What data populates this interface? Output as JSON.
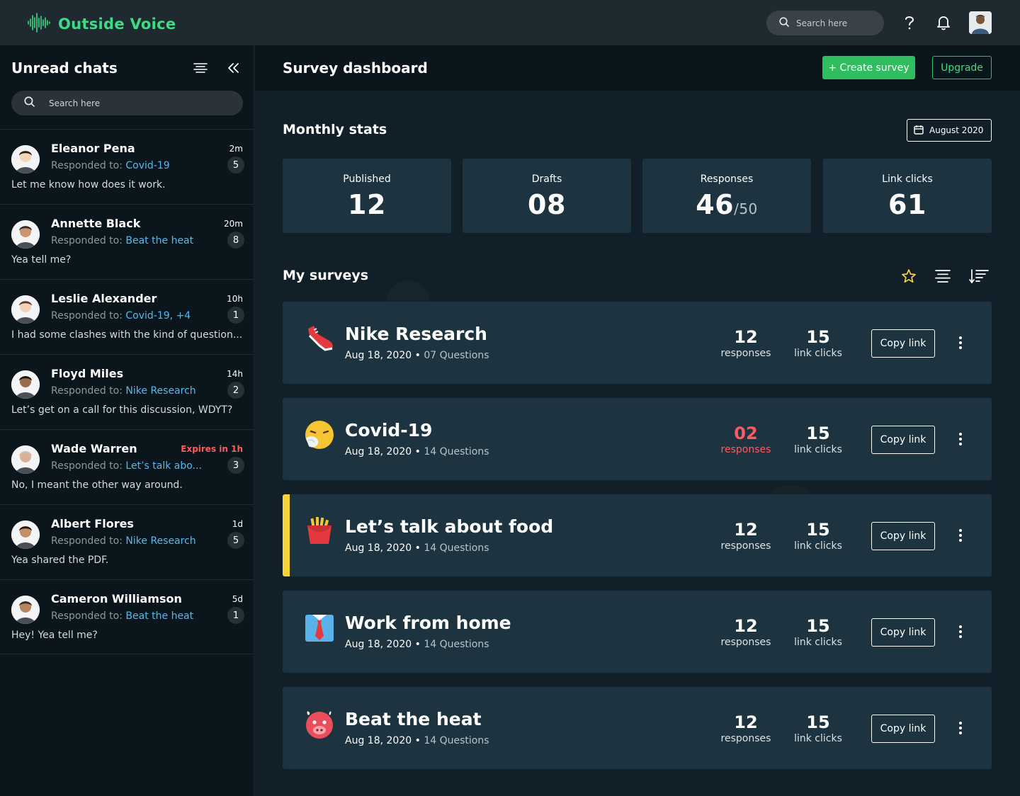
{
  "app": {
    "name": "Outside Voice",
    "search_placeholder": "Search here",
    "colors": {
      "accent": "#3ddc84",
      "primary_button": "#2fbd5f",
      "alert": "#ff5a5f",
      "highlight": "#f6d23b",
      "card": "#1d3440"
    },
    "icons": [
      "soundwave-logo-icon",
      "search-icon",
      "help-icon",
      "bell-icon",
      "user-avatar"
    ]
  },
  "sidebar": {
    "title": "Unread chats",
    "search_placeholder": "Search here",
    "responded_prefix": "Responded to:",
    "chats": [
      {
        "name": "Eleanor Pena",
        "time": "2m",
        "time_alert": false,
        "topic": "Covid-19",
        "count": "5",
        "message": "Let me know how does it work."
      },
      {
        "name": "Annette Black",
        "time": "20m",
        "time_alert": false,
        "topic": "Beat the heat",
        "count": "8",
        "message": "Yea tell me?"
      },
      {
        "name": "Leslie Alexander",
        "time": "10h",
        "time_alert": false,
        "topic": "Covid-19, +4",
        "count": "1",
        "message": "I had some clashes with the kind of question..."
      },
      {
        "name": "Floyd Miles",
        "time": "14h",
        "time_alert": false,
        "topic": "Nike Research",
        "count": "2",
        "message": "Let’s get on a call for this discussion, WDYT?"
      },
      {
        "name": "Wade Warren",
        "time": "Expires in 1h",
        "time_alert": true,
        "topic": "Let’s talk abo...",
        "count": "3",
        "message": "No, I meant the other way around."
      },
      {
        "name": "Albert Flores",
        "time": "1d",
        "time_alert": false,
        "topic": "Nike Research",
        "count": "5",
        "message": "Yea shared the PDF."
      },
      {
        "name": "Cameron Williamson",
        "time": "5d",
        "time_alert": false,
        "topic": "Beat the heat",
        "count": "1",
        "message": "Hey! Yea tell me?"
      }
    ]
  },
  "dashboard": {
    "title": "Survey dashboard",
    "create_label": "+ Create survey",
    "upgrade_label": "Upgrade",
    "monthly_title": "Monthly stats",
    "month": "August 2020",
    "stats": [
      {
        "label": "Published",
        "value": "12",
        "suffix": ""
      },
      {
        "label": "Drafts",
        "value": "08",
        "suffix": ""
      },
      {
        "label": "Responses",
        "value": "46",
        "suffix": "/50"
      },
      {
        "label": "Link clicks",
        "value": "61",
        "suffix": ""
      }
    ],
    "surveys_title": "My surveys",
    "toolbar_icons": [
      "star-icon",
      "align-center-icon",
      "sort-icon"
    ],
    "copy_label": "Copy link",
    "responses_label": "responses",
    "clicks_label": "link clicks",
    "surveys": [
      {
        "title": "Nike Research",
        "date": "Aug 18, 2020",
        "questions": "07 Questions",
        "responses": "12",
        "clicks": "15",
        "alert": false,
        "active": false,
        "icon": "sneaker-icon"
      },
      {
        "title": "Covid-19",
        "date": "Aug 18, 2020",
        "questions": "14 Questions",
        "responses": "02",
        "clicks": "15",
        "alert": true,
        "active": false,
        "icon": "sneezing-face-icon"
      },
      {
        "title": "Let’s talk about food",
        "date": "Aug 18, 2020",
        "questions": "14 Questions",
        "responses": "12",
        "clicks": "15",
        "alert": false,
        "active": true,
        "icon": "fries-icon"
      },
      {
        "title": "Work from home",
        "date": "Aug 18, 2020",
        "questions": "14 Questions",
        "responses": "12",
        "clicks": "15",
        "alert": false,
        "active": false,
        "icon": "shirt-tie-icon"
      },
      {
        "title": "Beat the heat",
        "date": "Aug 18, 2020",
        "questions": "14 Questions",
        "responses": "12",
        "clicks": "15",
        "alert": false,
        "active": false,
        "icon": "hot-face-icon"
      }
    ]
  }
}
